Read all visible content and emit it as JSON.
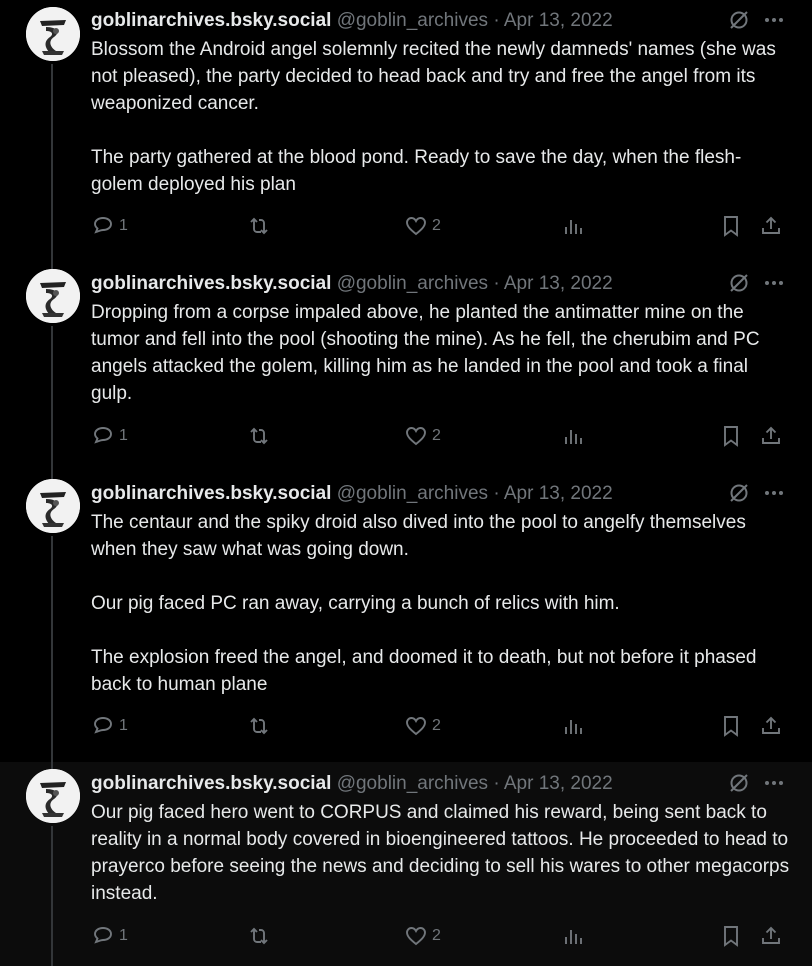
{
  "posts": [
    {
      "display_name": "goblinarchives.bsky.social",
      "handle": "@goblin_archives",
      "separator": "·",
      "date": "Apr 13, 2022",
      "paragraphs": [
        "Blossom the Android angel solemnly recited the newly damneds' names (she was not pleased), the party decided to head back and try and free the angel from its weaponized cancer.",
        "The party gathered at the blood pond. Ready to save the day, when the flesh-golem deployed his plan"
      ],
      "reply_count": "1",
      "like_count": "2"
    },
    {
      "display_name": "goblinarchives.bsky.social",
      "handle": "@goblin_archives",
      "separator": "·",
      "date": "Apr 13, 2022",
      "paragraphs": [
        "Dropping from a corpse impaled above, he planted the antimatter mine on the tumor and fell into the pool (shooting the mine). As he fell, the cherubim and PC angels attacked the golem, killing him as he landed in the pool and took a final gulp."
      ],
      "reply_count": "1",
      "like_count": "2"
    },
    {
      "display_name": "goblinarchives.bsky.social",
      "handle": "@goblin_archives",
      "separator": "·",
      "date": "Apr 13, 2022",
      "paragraphs": [
        "The centaur and the spiky droid also dived into the pool to angelfy themselves when they saw what was going down.",
        "Our pig faced PC ran away, carrying a bunch of relics with him.",
        "The explosion freed the angel, and doomed it to death, but not before it phased back to human plane"
      ],
      "reply_count": "1",
      "like_count": "2"
    },
    {
      "display_name": "goblinarchives.bsky.social",
      "handle": "@goblin_archives",
      "separator": "·",
      "date": "Apr 13, 2022",
      "paragraphs": [
        "Our pig faced hero went to CORPUS and claimed his reward, being sent back to reality in a normal body covered in bioengineered tattoos. He proceeded to head to prayerco before seeing the news and deciding to sell his wares to other megacorps instead."
      ],
      "reply_count": "1",
      "like_count": "2"
    }
  ],
  "icons": {
    "reply": "reply-icon",
    "repost": "repost-icon",
    "like": "heart-icon",
    "views": "views-icon",
    "bookmark": "bookmark-icon",
    "share": "share-icon",
    "grok": "grok-icon",
    "more": "more-icon"
  },
  "colors": {
    "background": "#000000",
    "text": "#e7e9ea",
    "muted": "#71767b",
    "rail": "#333639"
  }
}
